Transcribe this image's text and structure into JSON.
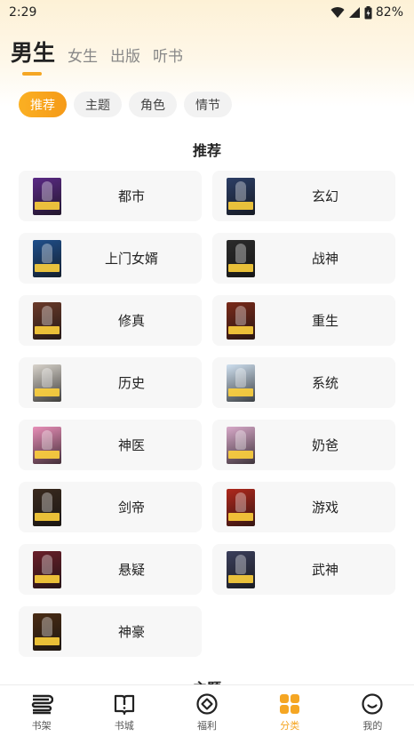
{
  "status_bar": {
    "time": "2:29",
    "battery": "82%"
  },
  "top_tabs": [
    {
      "label": "男生",
      "active": true
    },
    {
      "label": "女生",
      "active": false
    },
    {
      "label": "出版",
      "active": false
    },
    {
      "label": "听书",
      "active": false
    }
  ],
  "chips": [
    {
      "label": "推荐",
      "active": true
    },
    {
      "label": "主题",
      "active": false
    },
    {
      "label": "角色",
      "active": false
    },
    {
      "label": "情节",
      "active": false
    }
  ],
  "section": {
    "title": "推荐"
  },
  "categories": [
    {
      "label": "都市",
      "cover_color": "#5b2a86"
    },
    {
      "label": "玄幻",
      "cover_color": "#2c3e66"
    },
    {
      "label": "上门女婿",
      "cover_color": "#1f4f8c"
    },
    {
      "label": "战神",
      "cover_color": "#2b2b2b"
    },
    {
      "label": "修真",
      "cover_color": "#6b3a2a"
    },
    {
      "label": "重生",
      "cover_color": "#7a2a1a"
    },
    {
      "label": "历史",
      "cover_color": "#d9d4cc"
    },
    {
      "label": "系统",
      "cover_color": "#cfe0f0"
    },
    {
      "label": "神医",
      "cover_color": "#e88fb8"
    },
    {
      "label": "奶爸",
      "cover_color": "#d8a9c9"
    },
    {
      "label": "剑帝",
      "cover_color": "#3a2a1e"
    },
    {
      "label": "游戏",
      "cover_color": "#b0281c"
    },
    {
      "label": "悬疑",
      "cover_color": "#6a1f2a"
    },
    {
      "label": "武神",
      "cover_color": "#3b3f5c"
    },
    {
      "label": "神豪",
      "cover_color": "#4a2c14"
    }
  ],
  "next_section": {
    "title": "主题"
  },
  "bottom_nav": [
    {
      "label": "书架",
      "icon": "bookshelf-icon",
      "active": false
    },
    {
      "label": "书城",
      "icon": "book-store-icon",
      "active": false
    },
    {
      "label": "福利",
      "icon": "welfare-icon",
      "active": false
    },
    {
      "label": "分类",
      "icon": "category-icon",
      "active": true
    },
    {
      "label": "我的",
      "icon": "profile-icon",
      "active": false
    }
  ],
  "colors": {
    "accent": "#f5a623",
    "card_bg": "#f7f7f7",
    "chip_bg": "#f2f2f2"
  }
}
